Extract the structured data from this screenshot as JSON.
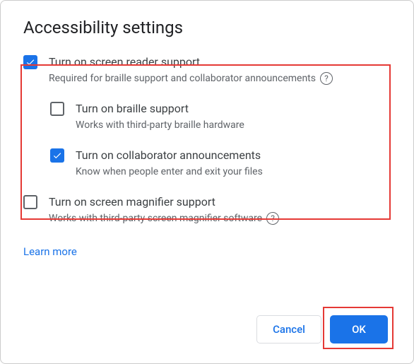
{
  "title": "Accessibility settings",
  "options": {
    "screen_reader": {
      "label": "Turn on screen reader support",
      "desc": "Required for braille support and collaborator announcements"
    },
    "braille": {
      "label": "Turn on braille support",
      "desc": "Works with third-party braille hardware"
    },
    "collab": {
      "label": "Turn on collaborator announcements",
      "desc": "Know when people enter and exit your files"
    },
    "magnifier": {
      "label": "Turn on screen magnifier support",
      "desc": "Works with third-party screen magnifier software"
    }
  },
  "learn_more": "Learn more",
  "buttons": {
    "cancel": "Cancel",
    "ok": "OK"
  },
  "help_glyph": "?"
}
